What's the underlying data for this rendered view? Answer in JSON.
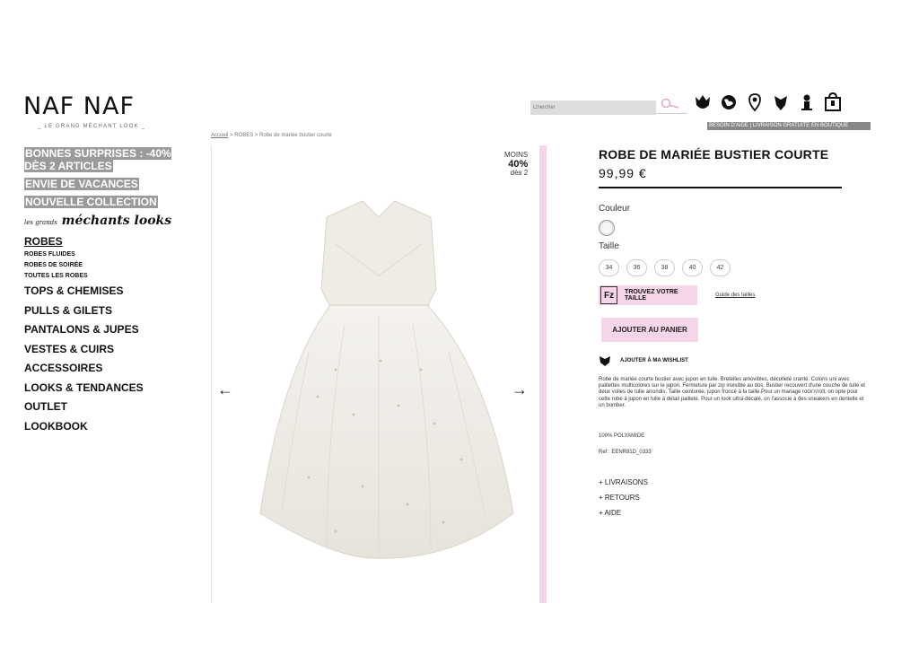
{
  "brand": {
    "name": "NAF NAF",
    "tagline": "_ LE GRAND MÉCHANT LOOK _"
  },
  "header": {
    "search_placeholder": "Chercher",
    "help_strip": "BESOIN D'AIDE | LIVRAISON GRATUITE EN BOUTIQUE"
  },
  "sidebar": {
    "promos": [
      "BONNES SURPRISES : -40% DÈS 2 ARTICLES",
      "ENVIE DE VACANCES",
      "NOUVELLE COLLECTION"
    ],
    "script_small": "les grands",
    "script_main": "méchants looks",
    "active_category": "ROBES",
    "subcategories": [
      "ROBES FLUIDES",
      "ROBES DE SOIRÉE",
      "TOUTES LES ROBES"
    ],
    "categories": [
      "TOPS & CHEMISES",
      "PULLS & GILETS",
      "PANTALONS & JUPES",
      "VESTES & CUIRS",
      "ACCESSOIRES",
      "LOOKS & TENDANCES",
      "OUTLET",
      "LOOKBOOK"
    ]
  },
  "breadcrumb": {
    "home": "Accueil",
    "sep": " > ",
    "section": "ROBES",
    "current": "Robe de mariée bustier courte"
  },
  "badge": {
    "line1": "MOINS",
    "line2": "40%",
    "line3": "dès 2"
  },
  "arrows": {
    "prev": "←",
    "next": "→"
  },
  "product": {
    "name": "ROBE DE MARIÉE BUSTIER COURTE",
    "price": "99,99 €",
    "color_label": "Couleur",
    "size_label": "Taille",
    "sizes": [
      "34",
      "36",
      "38",
      "40",
      "42"
    ],
    "fz_badge": "Fz",
    "fz_text": "TROUVEZ VOTRE TAILLE",
    "size_guide": "Guide des tailles",
    "add_to_cart": "AJOUTER AU PANIER",
    "wishlist": "AJOUTER À MA WISHLIST",
    "description": "Robe de mariée courte bustier avec jupon en tulle. Bretelles amovibles, décolleté cranté. Coloris uni avec paillettes multicolores sur le jupon. Fermeture par zip invisible au dos. Bustier recouvert d'une couche de tulle et deux voiles de tulle arrondis. Taille ceinturée, jupon froncé à la taille.Pour un mariage rock'n'roll, on opte pour cette robe à jupon en tulle à détail pailleté. Pour un look ultra-décalé, on l'associe à des sneakers en dentelle et un bomber.",
    "composition": "100% POLYAMIDE",
    "reference": "Ref : EENR81D_0333",
    "expanders": [
      "+ LIVRAISONS",
      "+ RETOURS",
      "+ AIDE"
    ]
  },
  "colors": {
    "pink_accent": "#f4d6e8",
    "promo_gray": "#9a9a9a"
  },
  "icons": [
    "search-icon",
    "tulip-icon",
    "globe-icon",
    "location-pin-icon",
    "heart-icon",
    "account-icon",
    "bag-icon"
  ]
}
